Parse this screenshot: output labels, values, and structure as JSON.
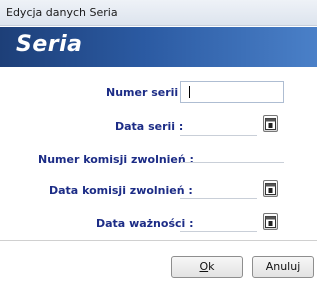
{
  "window": {
    "title": "Edycja danych Seria"
  },
  "banner": {
    "title": "Seria"
  },
  "form": {
    "numer_serii_label": "Numer serii :",
    "data_serii_label": "Data serii :",
    "numer_komisji_label": "Numer komisji zwolnień :",
    "data_komisji_label": "Data komisji zwolnień :",
    "data_waznosci_label": "Data ważności :",
    "numer_serii_value": "",
    "data_serii_value": "",
    "numer_komisji_value": "",
    "data_komisji_value": "",
    "data_waznosci_value": ""
  },
  "buttons": {
    "ok_label_underlined": "O",
    "ok_label_rest": "k",
    "cancel_label": "Anuluj"
  },
  "icons": {
    "calendar": "calendar-icon"
  }
}
